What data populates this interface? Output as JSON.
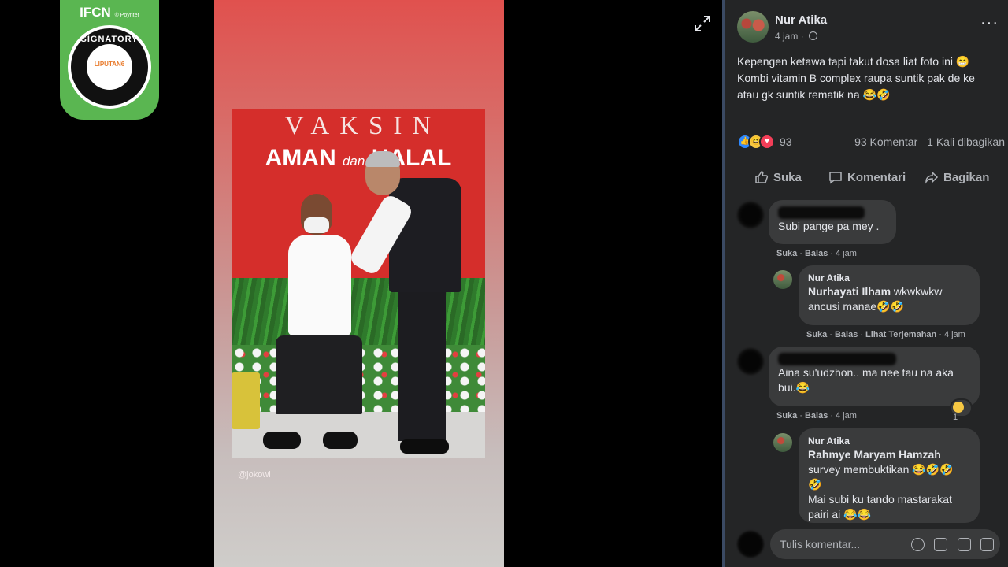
{
  "badge": {
    "top_text": "IFCN",
    "top_small": "® Poynter",
    "ring_text": "SIGNATORY",
    "brand": "LIPUTAN6"
  },
  "photo": {
    "banner_top": "VAKSIN",
    "banner_aman": "AMAN ",
    "banner_dan": "dan",
    "banner_halal": "HALAL",
    "credit": "@jokowi"
  },
  "post": {
    "author": "Nur Atika",
    "time": "4 jam",
    "text_line1": "Kepengen ketawa tapi takut dosa liat foto ini 😁",
    "text_line2": "Kombi vitamin B complex raupa suntik pak de ke",
    "text_line3": "atau gk suntik rematik na 😂🤣",
    "reaction_count": "93",
    "comment_count": "93 Komentar",
    "share_count": "1 Kali dibagikan"
  },
  "actions": {
    "like": "Suka",
    "comment": "Komentari",
    "share": "Bagikan"
  },
  "comments": [
    {
      "text": "Subi pange pa mey .",
      "meta_like": "Suka",
      "meta_reply": "Balas",
      "time": "4 jam"
    },
    {
      "name": "Nur Atika",
      "tag": "Nurhayati Ilham",
      "text_after_tag": " wkwkwkw",
      "text_line2": "ancusi manae🤣🤣",
      "meta_like": "Suka",
      "meta_reply": "Balas",
      "meta_translate": "Lihat Terjemahan",
      "time": "4 jam"
    },
    {
      "text_line1": "Aina su'udzhon.. ma nee tau na aka",
      "text_line2": "bui.😂",
      "meta_like": "Suka",
      "meta_reply": "Balas",
      "time": "4 jam",
      "reaction_count": "1"
    },
    {
      "name": "Nur Atika",
      "tag": "Rahmye Maryam Hamzah",
      "text_line2": "survey membuktikan 😂🤣🤣",
      "text_line3": "🤣",
      "text_line4": "Mai subi ku tando mastarakat",
      "text_line5": "pairi ai 😂😂"
    }
  ],
  "composer": {
    "placeholder": "Tulis komentar..."
  }
}
